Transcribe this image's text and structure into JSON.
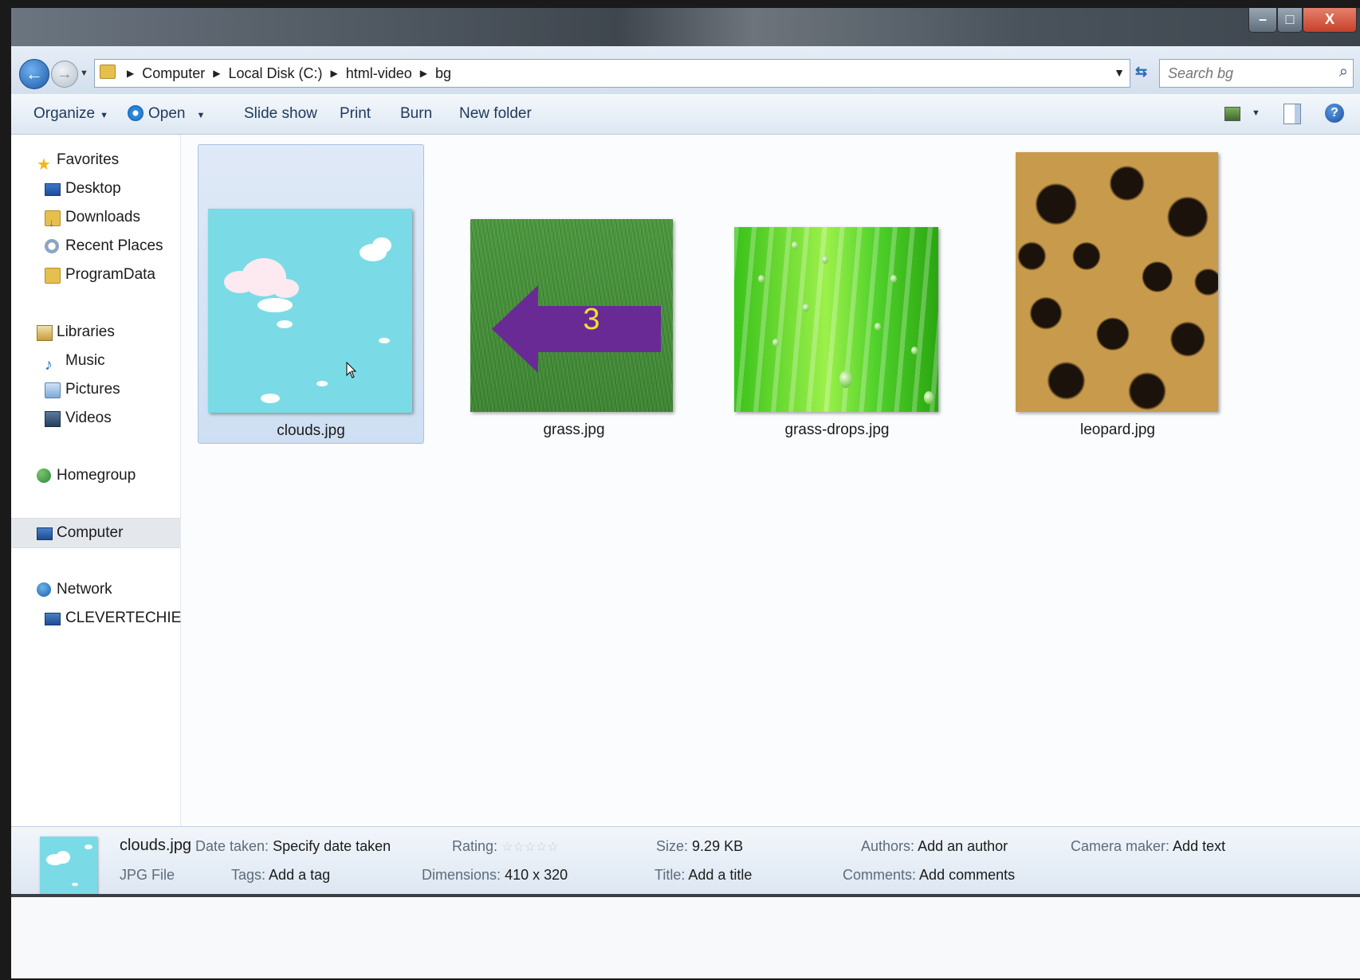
{
  "window": {
    "controls": {
      "minimize": "–",
      "maximize": "□",
      "close": "X"
    }
  },
  "nav": {
    "back_glyph": "←",
    "forward_glyph": "→"
  },
  "address": {
    "segments": [
      "Computer",
      "Local Disk (C:)",
      "html-video",
      "bg"
    ]
  },
  "search": {
    "placeholder": "Search bg"
  },
  "toolbar": {
    "organize": "Organize",
    "open": "Open",
    "slideshow": "Slide show",
    "print": "Print",
    "burn": "Burn",
    "new_folder": "New folder",
    "help_glyph": "?"
  },
  "sidebar": {
    "items": [
      {
        "label": "Favorites",
        "icon": "star-icon"
      },
      {
        "label": "Desktop",
        "icon": "desktop-icon"
      },
      {
        "label": "Downloads",
        "icon": "downloads-folder-icon"
      },
      {
        "label": "Recent Places",
        "icon": "recent-places-icon"
      },
      {
        "label": "ProgramData",
        "icon": "folder-icon"
      },
      {
        "label": "Libraries",
        "icon": "libraries-icon"
      },
      {
        "label": "Music",
        "icon": "music-icon"
      },
      {
        "label": "Pictures",
        "icon": "pictures-icon"
      },
      {
        "label": "Videos",
        "icon": "videos-icon"
      },
      {
        "label": "Homegroup",
        "icon": "homegroup-icon"
      },
      {
        "label": "Computer",
        "icon": "computer-icon"
      },
      {
        "label": "Network",
        "icon": "network-icon"
      },
      {
        "label": "CLEVERTECHIE",
        "icon": "computer-icon"
      }
    ]
  },
  "files": [
    {
      "name": "clouds.jpg",
      "selected": true
    },
    {
      "name": "grass.jpg",
      "selected": false
    },
    {
      "name": "grass-drops.jpg",
      "selected": false
    },
    {
      "name": "leopard.jpg",
      "selected": false
    }
  ],
  "annotation": {
    "number": "3",
    "color": "#6a2a96",
    "text_color": "#f3e02c"
  },
  "details": {
    "name": "clouds.jpg",
    "type": "JPG File",
    "date_taken_label": "Date taken:",
    "date_taken_value": "Specify date taken",
    "tags_label": "Tags:",
    "tags_value": "Add a tag",
    "rating_label": "Rating:",
    "rating_stars": "☆☆☆☆☆",
    "dimensions_label": "Dimensions:",
    "dimensions_value": "410 x 320",
    "size_label": "Size:",
    "size_value": "9.29 KB",
    "title_label": "Title:",
    "title_value": "Add a title",
    "authors_label": "Authors:",
    "authors_value": "Add an author",
    "comments_label": "Comments:",
    "comments_value": "Add comments",
    "camera_label": "Camera maker:",
    "camera_value": "Add text"
  }
}
